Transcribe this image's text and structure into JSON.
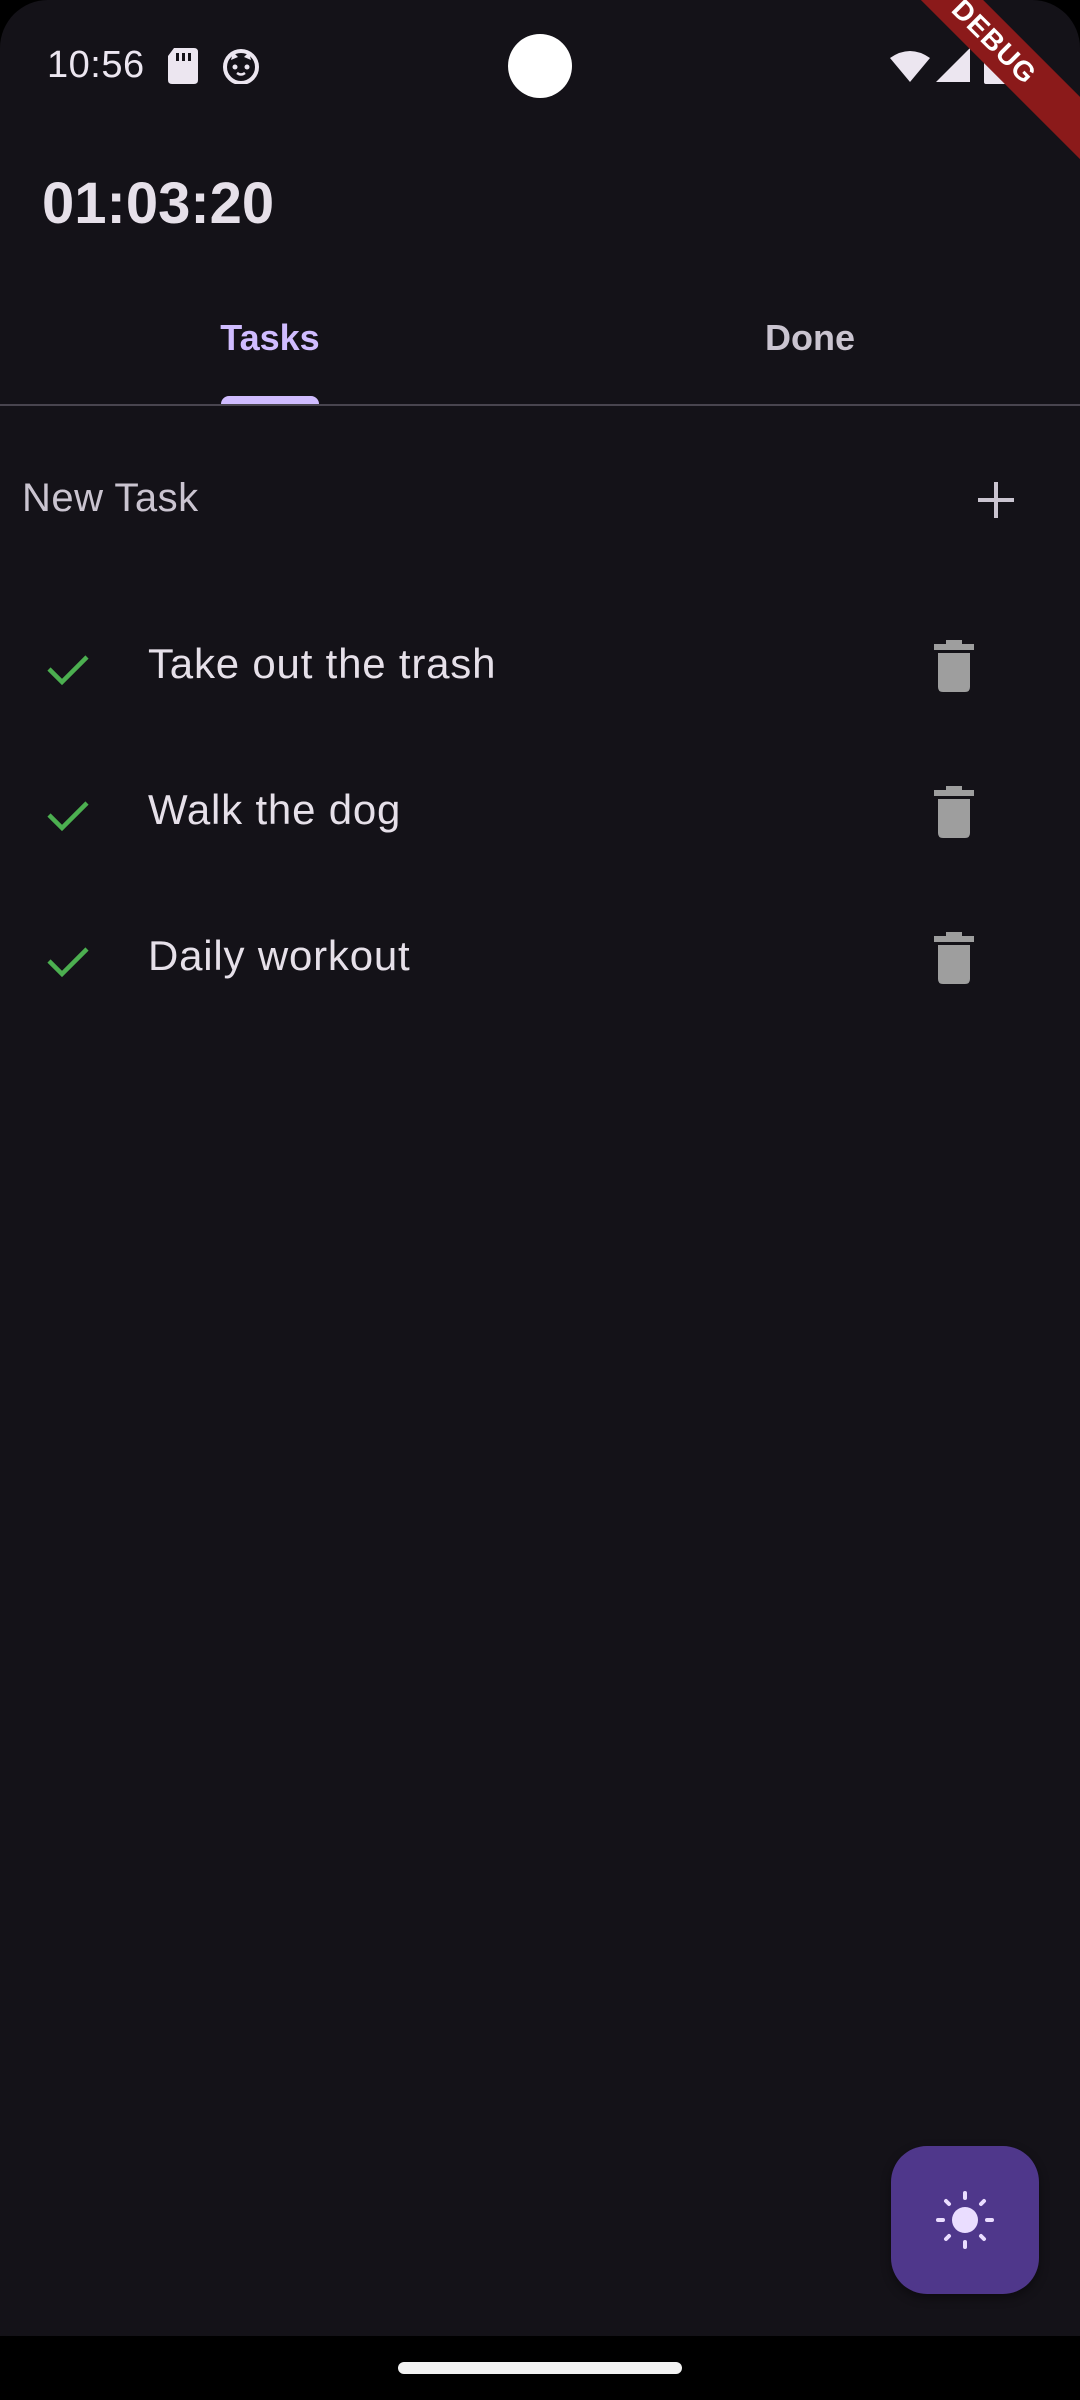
{
  "status_bar": {
    "time": "10:56",
    "debug_label": "DEBUG",
    "icons": [
      "sd-card-icon",
      "cat-face-icon",
      "wifi-icon",
      "signal-icon",
      "battery-icon"
    ]
  },
  "app_bar": {
    "title": "01:03:20"
  },
  "tabs": [
    {
      "label": "Tasks",
      "active": true
    },
    {
      "label": "Done",
      "active": false
    }
  ],
  "new_task": {
    "placeholder": "New Task",
    "value": "",
    "add_icon": "plus-icon"
  },
  "tasks": [
    {
      "label": "Take out the trash",
      "done_icon": "check-icon",
      "delete_icon": "trash-icon"
    },
    {
      "label": "Walk the dog",
      "done_icon": "check-icon",
      "delete_icon": "trash-icon"
    },
    {
      "label": "Daily workout",
      "done_icon": "check-icon",
      "delete_icon": "trash-icon"
    }
  ],
  "fab": {
    "icon": "brightness-icon"
  },
  "colors": {
    "background": "#141218",
    "accent": "#D0BCFF",
    "check": "#4CAF50",
    "fab": "#4F378B",
    "debug_banner": "#8B1A1A"
  }
}
